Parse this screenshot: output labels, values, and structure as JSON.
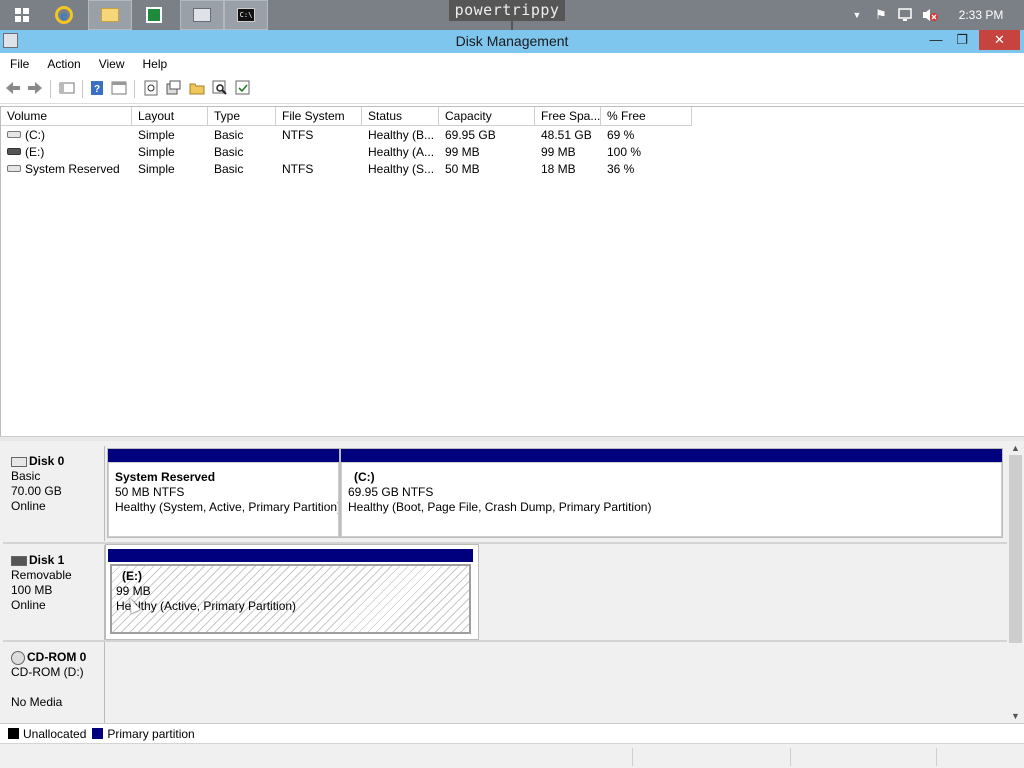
{
  "taskbar": {
    "watermark": "powertrippy",
    "clock": "2:33 PM"
  },
  "window": {
    "title": "Disk Management"
  },
  "menu": [
    "File",
    "Action",
    "View",
    "Help"
  ],
  "volume_list": {
    "columns": [
      "Volume",
      "Layout",
      "Type",
      "File System",
      "Status",
      "Capacity",
      "Free Spa...",
      "% Free"
    ],
    "rows": [
      {
        "volume": "(C:)",
        "layout": "Simple",
        "type": "Basic",
        "fs": "NTFS",
        "status": "Healthy (B...",
        "capacity": "69.95 GB",
        "free": "48.51 GB",
        "pct": "69 %",
        "icon": "drive-icon"
      },
      {
        "volume": "(E:)",
        "layout": "Simple",
        "type": "Basic",
        "fs": "",
        "status": "Healthy (A...",
        "capacity": "99 MB",
        "free": "99 MB",
        "pct": "100 %",
        "icon": "removable-drive-icon"
      },
      {
        "volume": "System Reserved",
        "layout": "Simple",
        "type": "Basic",
        "fs": "NTFS",
        "status": "Healthy (S...",
        "capacity": "50 MB",
        "free": "18 MB",
        "pct": "36 %",
        "icon": "drive-icon"
      }
    ]
  },
  "disks": [
    {
      "name": "Disk 0",
      "kind": "Basic",
      "size": "70.00 GB",
      "state": "Online",
      "partitions": [
        {
          "name": "System Reserved",
          "size_fs": "50 MB NTFS",
          "status": "Healthy (System, Active, Primary Partition)"
        },
        {
          "name": "(C:)",
          "size_fs": "69.95 GB NTFS",
          "status": "Healthy (Boot, Page File, Crash Dump, Primary Partition)"
        }
      ]
    },
    {
      "name": "Disk 1",
      "kind": "Removable",
      "size": "100 MB",
      "state": "Online",
      "partitions": [
        {
          "name": "(E:)",
          "size_fs": "99 MB",
          "status": "Healthy (Active, Primary Partition)"
        }
      ]
    },
    {
      "name": "CD-ROM 0",
      "kind": "CD-ROM (D:)",
      "size": "",
      "state": "No Media",
      "partitions": []
    }
  ],
  "legend": {
    "unallocated": "Unallocated",
    "primary": "Primary partition",
    "colors": {
      "unallocated": "#000000",
      "primary": "#00007f"
    }
  }
}
